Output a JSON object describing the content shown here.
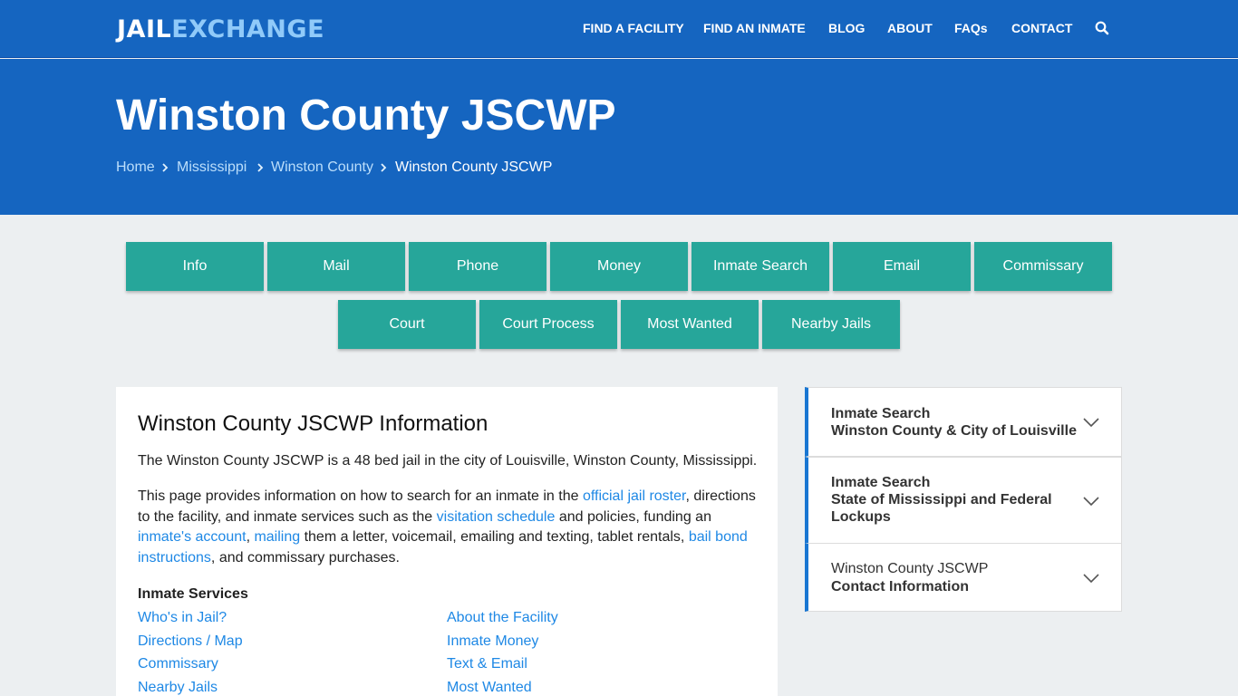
{
  "header": {
    "logo_part1": "JAIL",
    "logo_part2": "EXCHANGE",
    "nav": [
      "FIND A FACILITY",
      "FIND AN INMATE",
      "BLOG",
      "ABOUT",
      "FAQs",
      "CONTACT"
    ],
    "search_icon": "search-icon"
  },
  "hero": {
    "title": "Winston County JSCWP",
    "breadcrumb": [
      "Home",
      "Mississippi",
      "Winston County",
      "Winston County JSCWP"
    ]
  },
  "tabs": {
    "row1": [
      "Info",
      "Mail",
      "Phone",
      "Money",
      "Inmate Search",
      "Email",
      "Commissary"
    ],
    "row2": [
      "Court",
      "Court Process",
      "Most Wanted",
      "Nearby Jails"
    ]
  },
  "main": {
    "heading": "Winston County JSCWP Information",
    "intro": "The Winston County JSCWP is a 48 bed jail in the city of Louisville, Winston County, Mississippi.",
    "p2": {
      "t1": "This page provides information on how to search for an inmate in the ",
      "l1": "official jail roster",
      "t2": ", directions to the facility, and inmate services such as the ",
      "l2": "visitation schedule",
      "t3": " and policies, funding an ",
      "l3": "inmate's account",
      "t4": ", ",
      "l4": "mailing",
      "t5": " them a letter, voicemail, emailing and texting, tablet rentals, ",
      "l5": "bail bond instructions",
      "t6": ", and commissary purchases."
    },
    "services_title": "Inmate Services",
    "services_left": [
      "Who's in Jail?",
      "Directions / Map",
      "Commissary",
      "Nearby Jails"
    ],
    "services_right": [
      "About the Facility",
      "Inmate Money",
      "Text & Email",
      "Most Wanted"
    ]
  },
  "sidebar": [
    {
      "line1": "Inmate Search",
      "line2": "Winston County & City of Louisville",
      "line3": ""
    },
    {
      "line1": "Inmate Search",
      "line2": "State of Mississippi and Federal",
      "line3": "Lockups"
    },
    {
      "line1": "Winston County JSCWP",
      "line2": "Contact Information",
      "line3": ""
    }
  ],
  "colors": {
    "brand_blue": "#1565c0",
    "teal_button": "#26a69a",
    "link": "#1e88e5"
  }
}
